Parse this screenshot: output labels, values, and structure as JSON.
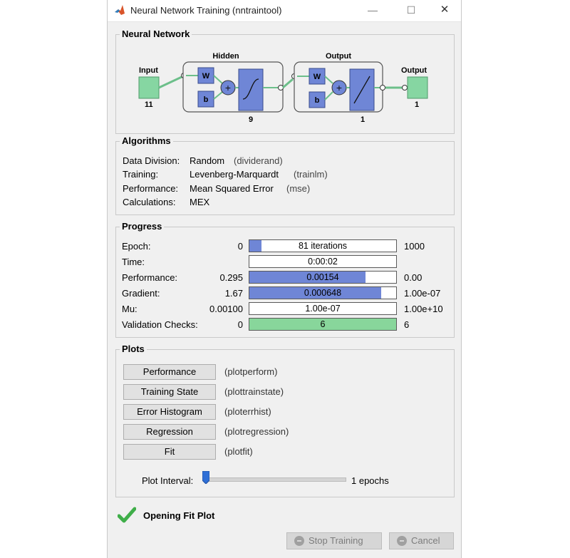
{
  "window": {
    "title": "Neural Network Training (nntraintool)",
    "minimize_glyph": "—",
    "maximize_glyph": "☐",
    "close_glyph": "✕"
  },
  "neural_network": {
    "section_title": "Neural Network",
    "input_label": "Input",
    "input_size": "11",
    "hidden_label": "Hidden",
    "hidden_size": "9",
    "output_layer_label": "Output",
    "output_layer_size": "1",
    "output_label": "Output",
    "output_size": "1",
    "weight_symbol": "W",
    "bias_symbol": "b",
    "sum_symbol": "+"
  },
  "algorithms": {
    "section_title": "Algorithms",
    "rows": [
      {
        "label": "Data Division:",
        "value": "Random",
        "func": "(dividerand)"
      },
      {
        "label": "Training:",
        "value": "Levenberg-Marquardt",
        "func": "(trainlm)"
      },
      {
        "label": "Performance:",
        "value": "Mean Squared Error",
        "func": "(mse)"
      },
      {
        "label": "Calculations:",
        "value": "MEX",
        "func": ""
      }
    ]
  },
  "progress": {
    "section_title": "Progress",
    "rows": [
      {
        "label": "Epoch:",
        "start": "0",
        "bar_text": "81 iterations",
        "end": "1000",
        "fraction": 0.081,
        "color": "#6f86d6"
      },
      {
        "label": "Time:",
        "start": "",
        "bar_text": "0:00:02",
        "end": "",
        "fraction": 0,
        "color": "#6f86d6"
      },
      {
        "label": "Performance:",
        "start": "0.295",
        "bar_text": "0.00154",
        "end": "0.00",
        "fraction": 0.79,
        "color": "#6f86d6"
      },
      {
        "label": "Gradient:",
        "start": "1.67",
        "bar_text": "0.000648",
        "end": "1.00e-07",
        "fraction": 0.9,
        "color": "#6f86d6"
      },
      {
        "label": "Mu:",
        "start": "0.00100",
        "bar_text": "1.00e-07",
        "end": "1.00e+10",
        "fraction": 0,
        "color": "#6f86d6"
      },
      {
        "label": "Validation Checks:",
        "start": "0",
        "bar_text": "6",
        "end": "6",
        "fraction": 1.0,
        "color": "#88d69b"
      }
    ]
  },
  "plots": {
    "section_title": "Plots",
    "buttons": [
      {
        "label": "Performance",
        "func": "(plotperform)"
      },
      {
        "label": "Training State",
        "func": "(plottrainstate)"
      },
      {
        "label": "Error Histogram",
        "func": "(ploterrhist)"
      },
      {
        "label": "Regression",
        "func": "(plotregression)"
      },
      {
        "label": "Fit",
        "func": "(plotfit)"
      }
    ],
    "interval_label": "Plot Interval:",
    "interval_value": "1 epochs",
    "interval_fraction": 0.0
  },
  "status": {
    "icon": "checkmark-icon",
    "text": "Opening Fit Plot"
  },
  "buttons": {
    "stop_training": "Stop Training",
    "cancel": "Cancel"
  },
  "colors": {
    "io_box": "#86d6a2",
    "layer_block": "#6f86d6",
    "check_green": "#3fae49",
    "window_bg": "#f0f0f0"
  }
}
